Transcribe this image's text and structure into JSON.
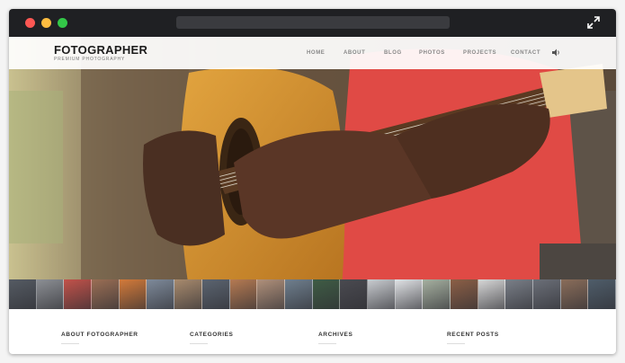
{
  "window": {
    "controls": [
      "close",
      "minimize",
      "maximize"
    ],
    "expand_icon": "expand-arrows-icon"
  },
  "header": {
    "logo": "FOTOGRAPHER",
    "tagline": "PREMIUM PHOTOGRAPHY",
    "nav": [
      "HOME",
      "ABOUT",
      "BLOG",
      "PHOTOS",
      "PROJECTS",
      "CONTACT"
    ],
    "sound_icon": "speaker-icon"
  },
  "hero": {
    "subject": "guitar-player-photo"
  },
  "thumbnails": {
    "colors": [
      "#555b63",
      "#8c8f94",
      "#c2524a",
      "#9a6e54",
      "#d37a3a",
      "#7e8a9a",
      "#a88a6d",
      "#5b6470",
      "#b57a52",
      "#b0907a",
      "#6f7f8e",
      "#3f5c45",
      "#4a4a50",
      "#c9ccd0",
      "#e0e2e5",
      "#a6b0a0",
      "#8c5f46",
      "#d7d7d7",
      "#7a7f88",
      "#6b6f78",
      "#8a6d5a",
      "#4f5d6a"
    ]
  },
  "footer": {
    "headings": [
      "ABOUT FOTOGRAPHER",
      "CATEGORIES",
      "ARCHIVES",
      "RECENT POSTS"
    ]
  }
}
